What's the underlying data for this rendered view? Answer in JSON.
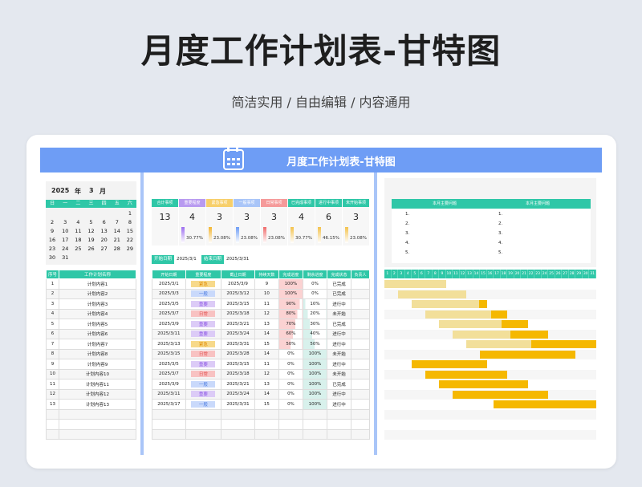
{
  "title": "月度工作计划表-甘特图",
  "subtitle": "简洁实用 / 自由编辑 / 内容通用",
  "banner_title": "月度工作计划表-甘特图",
  "calendar": {
    "year": "2025",
    "year_label": "年",
    "month": "3",
    "month_label": "月",
    "weekdays": [
      "日",
      "一",
      "二",
      "三",
      "四",
      "五",
      "六"
    ],
    "rows": [
      [
        "",
        "",
        "",
        "",
        "",
        "",
        "1"
      ],
      [
        "2",
        "3",
        "4",
        "5",
        "6",
        "7",
        "8"
      ],
      [
        "9",
        "10",
        "11",
        "12",
        "13",
        "14",
        "15"
      ],
      [
        "16",
        "17",
        "18",
        "19",
        "20",
        "21",
        "22"
      ],
      [
        "23",
        "24",
        "25",
        "26",
        "27",
        "28",
        "29"
      ],
      [
        "30",
        "31",
        "",
        "",
        "",
        "",
        ""
      ]
    ]
  },
  "task_list": {
    "headers": [
      "序号",
      "工作计划名称"
    ],
    "rows": [
      [
        "1",
        "计划内容1"
      ],
      [
        "2",
        "计划内容2"
      ],
      [
        "3",
        "计划内容3"
      ],
      [
        "4",
        "计划内容4"
      ],
      [
        "5",
        "计划内容5"
      ],
      [
        "6",
        "计划内容6"
      ],
      [
        "7",
        "计划内容7"
      ],
      [
        "8",
        "计划内容8"
      ],
      [
        "9",
        "计划内容9"
      ],
      [
        "10",
        "计划内容10"
      ],
      [
        "11",
        "计划内容11"
      ],
      [
        "12",
        "计划内容12"
      ],
      [
        "13",
        "计划内容13"
      ],
      [
        "",
        ""
      ],
      [
        "",
        ""
      ],
      [
        "",
        ""
      ]
    ]
  },
  "stats": [
    {
      "label": "合计事项",
      "value": "13",
      "pct": "",
      "color": "#2fc7a7",
      "pct_color": ""
    },
    {
      "label": "重要程度",
      "value": "4",
      "pct": "30.77%",
      "color": "#b89af0",
      "pct_color": "#9b6df0"
    },
    {
      "label": "紧急事项",
      "value": "3",
      "pct": "23.08%",
      "color": "#f7cf6a",
      "pct_color": "#f3b632"
    },
    {
      "label": "一般事项",
      "value": "3",
      "pct": "23.08%",
      "color": "#a9c5f8",
      "pct_color": "#6e9df5"
    },
    {
      "label": "日常事项",
      "value": "3",
      "pct": "23.08%",
      "color": "#f59a9a",
      "pct_color": "#ef6b6b"
    },
    {
      "label": "已完成事项",
      "value": "4",
      "pct": "30.77%",
      "color": "#2fc7a7",
      "pct_color": "#f3c24b"
    },
    {
      "label": "进行中事项",
      "value": "6",
      "pct": "46.15%",
      "color": "#2fc7a7",
      "pct_color": "#f3c24b"
    },
    {
      "label": "未开始事项",
      "value": "3",
      "pct": "23.08%",
      "color": "#2fc7a7",
      "pct_color": "#f3c24b"
    }
  ],
  "date_range": {
    "start_label": "开始日期",
    "start": "2025/3/1",
    "end_label": "结束日期",
    "end": "2025/3/31"
  },
  "detail": {
    "headers": [
      "开始日期",
      "重要程度",
      "截止日期",
      "持续天数",
      "完成进度",
      "剩余进度",
      "完成状态",
      "负责人"
    ],
    "rows": [
      [
        "2025/3/1",
        "紧急",
        "2025/3/9",
        "9",
        "100%",
        "0%",
        "已完成",
        ""
      ],
      [
        "2025/3/3",
        "一般",
        "2025/3/12",
        "10",
        "100%",
        "0%",
        "已完成",
        ""
      ],
      [
        "2025/3/5",
        "重要",
        "2025/3/15",
        "11",
        "90%",
        "10%",
        "进行中",
        ""
      ],
      [
        "2025/3/7",
        "日常",
        "2025/3/18",
        "12",
        "80%",
        "20%",
        "未开始",
        ""
      ],
      [
        "2025/3/9",
        "重要",
        "2025/3/21",
        "13",
        "70%",
        "30%",
        "已完成",
        ""
      ],
      [
        "2025/3/11",
        "重要",
        "2025/3/24",
        "14",
        "60%",
        "40%",
        "进行中",
        ""
      ],
      [
        "2025/3/13",
        "紧急",
        "2025/3/31",
        "15",
        "50%",
        "50%",
        "进行中",
        ""
      ],
      [
        "2025/3/15",
        "日常",
        "2025/3/28",
        "14",
        "0%",
        "100%",
        "未开始",
        ""
      ],
      [
        "2025/3/5",
        "重要",
        "2025/3/15",
        "11",
        "0%",
        "100%",
        "进行中",
        ""
      ],
      [
        "2025/3/7",
        "日常",
        "2025/3/18",
        "12",
        "0%",
        "100%",
        "未开始",
        ""
      ],
      [
        "2025/3/9",
        "一般",
        "2025/3/21",
        "13",
        "0%",
        "100%",
        "已完成",
        ""
      ],
      [
        "2025/3/11",
        "重要",
        "2025/3/24",
        "14",
        "0%",
        "100%",
        "进行中",
        ""
      ],
      [
        "2025/3/17",
        "一般",
        "2025/3/31",
        "15",
        "0%",
        "100%",
        "进行中",
        ""
      ],
      [
        "",
        "",
        "",
        "",
        "",
        "",
        "",
        ""
      ],
      [
        "",
        "",
        "",
        "",
        "",
        "",
        "",
        ""
      ],
      [
        "",
        "",
        "",
        "",
        "",
        "",
        "",
        ""
      ]
    ]
  },
  "priority_colors": {
    "紧急": "#f7d98a",
    "一般": "#c9d9fb",
    "重要": "#dccbf7",
    "日常": "#f8c2c2"
  },
  "priority_text": {
    "紧急": "#e08a00",
    "一般": "#4b7be0",
    "重要": "#8f5ae6",
    "日常": "#e05050"
  },
  "problems": [
    {
      "title": "本月主要问题",
      "items": [
        "1.",
        "2.",
        "3.",
        "4.",
        "5."
      ]
    },
    {
      "title": "本月主要问题",
      "items": [
        "1.",
        "2.",
        "3.",
        "4.",
        "5."
      ]
    }
  ],
  "gantt": {
    "days": [
      "1",
      "2",
      "3",
      "4",
      "5",
      "6",
      "7",
      "8",
      "9",
      "10",
      "11",
      "12",
      "13",
      "14",
      "15",
      "16",
      "17",
      "18",
      "19",
      "20",
      "21",
      "22",
      "23",
      "24",
      "25",
      "26",
      "27",
      "28",
      "29",
      "30",
      "31"
    ],
    "done_color": "#f2df9a",
    "remain_color": "#f5b800"
  }
}
